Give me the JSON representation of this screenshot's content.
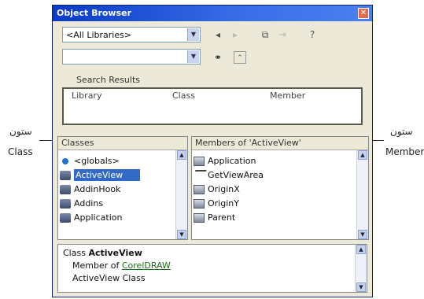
{
  "window": {
    "title": "Object Browser"
  },
  "toolbar": {
    "library_select": "<All Libraries>",
    "search_text": ""
  },
  "search_results": {
    "label": "Search Results",
    "columns": [
      "Library",
      "Class",
      "Member"
    ]
  },
  "classes": {
    "header": "Classes",
    "items": [
      {
        "label": "<globals>",
        "icon": "globals-icon"
      },
      {
        "label": "ActiveView",
        "icon": "class-icon",
        "selected": true
      },
      {
        "label": "AddinHook",
        "icon": "class-icon"
      },
      {
        "label": "Addins",
        "icon": "class-icon"
      },
      {
        "label": "Application",
        "icon": "class-icon"
      }
    ]
  },
  "members": {
    "header": "Members of 'ActiveView'",
    "items": [
      {
        "label": "Application",
        "icon": "property-icon"
      },
      {
        "label": "GetViewArea",
        "icon": "method-icon"
      },
      {
        "label": "OriginX",
        "icon": "property-icon"
      },
      {
        "label": "OriginY",
        "icon": "property-icon"
      },
      {
        "label": "Parent",
        "icon": "property-icon"
      }
    ]
  },
  "details": {
    "kind": "Class",
    "name": "ActiveView",
    "member_of_prefix": "Member of",
    "library_link": "CorelDRAW",
    "description": "ActiveView Class"
  },
  "annotations": {
    "left_ar": "ستون",
    "left_en": "Class",
    "right_ar": "ستون",
    "right_en": "Member"
  }
}
